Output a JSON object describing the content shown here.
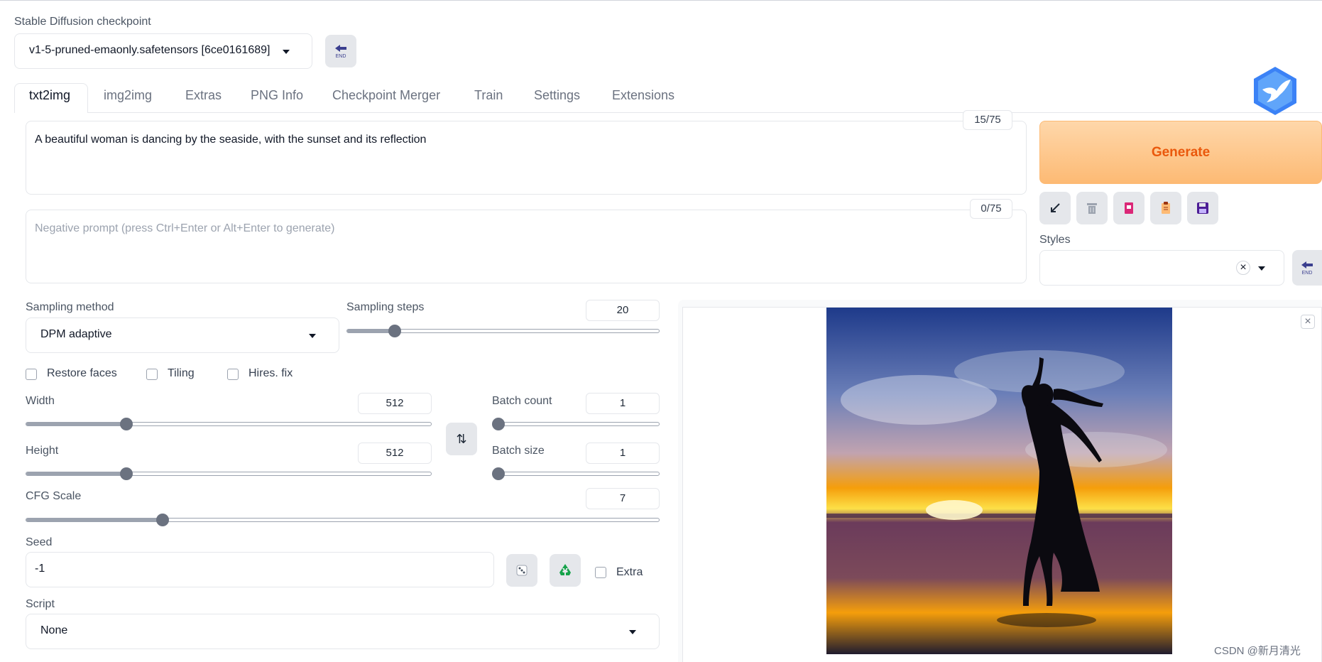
{
  "checkpoint": {
    "label": "Stable Diffusion checkpoint",
    "value": "v1-5-pruned-emaonly.safetensors [6ce0161689]"
  },
  "tabs": [
    {
      "label": "txt2img"
    },
    {
      "label": "img2img"
    },
    {
      "label": "Extras"
    },
    {
      "label": "PNG Info"
    },
    {
      "label": "Checkpoint Merger"
    },
    {
      "label": "Train"
    },
    {
      "label": "Settings"
    },
    {
      "label": "Extensions"
    }
  ],
  "prompt": {
    "value": "A beautiful woman is dancing by the seaside, with the sunset and its reflection",
    "counter": "15/75"
  },
  "negative_prompt": {
    "placeholder": "Negative prompt (press Ctrl+Enter or Alt+Enter to generate)",
    "counter": "0/75"
  },
  "generate": {
    "label": "Generate"
  },
  "tool_icons": [
    "arrow-in-icon",
    "trash-icon",
    "red-book-icon",
    "clipboard-icon",
    "floppy-disk-icon"
  ],
  "styles": {
    "label": "Styles",
    "clear": "×"
  },
  "sampling": {
    "method_label": "Sampling method",
    "method_value": "DPM adaptive",
    "steps_label": "Sampling steps",
    "steps_value": "20",
    "steps_fraction": 0.14
  },
  "checkboxes": {
    "restore_faces": "Restore faces",
    "tiling": "Tiling",
    "hires_fix": "Hires. fix",
    "extra": "Extra"
  },
  "width": {
    "label": "Width",
    "value": "512",
    "fraction": 0.24
  },
  "height": {
    "label": "Height",
    "value": "512",
    "fraction": 0.24
  },
  "swap_icon": "⇅",
  "batch_count": {
    "label": "Batch count",
    "value": "1",
    "fraction": 0.0
  },
  "batch_size": {
    "label": "Batch size",
    "value": "1",
    "fraction": 0.0
  },
  "cfg": {
    "label": "CFG Scale",
    "value": "7",
    "fraction": 0.21
  },
  "seed": {
    "label": "Seed",
    "value": "-1"
  },
  "script": {
    "label": "Script",
    "value": "None"
  },
  "output": {
    "close": "×"
  },
  "watermark": "CSDN @新月清光",
  "colors": {
    "generate_text": "#ea580c",
    "generate_bg_top": "#fed7aa",
    "generate_bg_bottom": "#fdba74",
    "accent": "#6b7280"
  }
}
